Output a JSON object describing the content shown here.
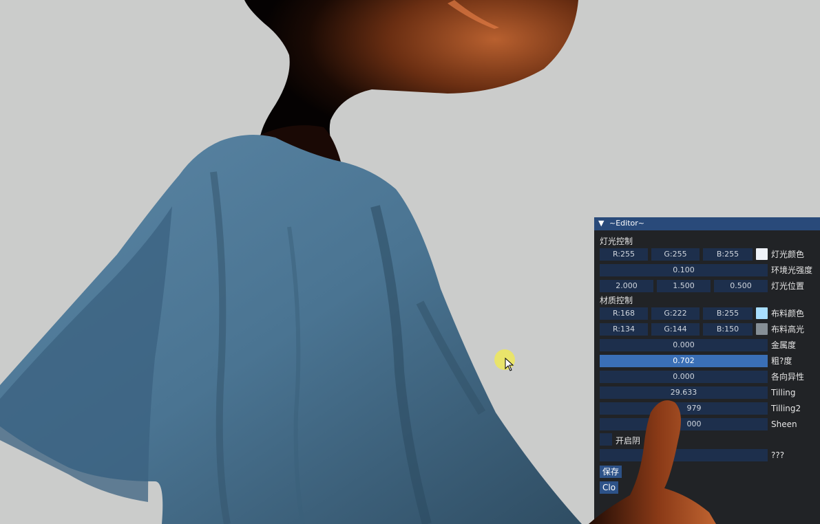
{
  "viewport": {
    "description_icon": "character-3d-scene",
    "colors": {
      "background": "#cbcccb",
      "cloth": "#4d7896",
      "skin_shadow": "#1a0c06",
      "skin": "#a85028"
    }
  },
  "editor": {
    "title": "~Editor~",
    "collapse_icon": "triangle-down-icon",
    "light_section": {
      "heading": "灯光控制",
      "light_color": {
        "r": "R:255",
        "g": "G:255",
        "b": "B:255",
        "label": "灯光颜色",
        "swatch": "#eef2f8"
      },
      "ambient": {
        "value": "0.100",
        "label": "环境光强度"
      },
      "light_pos": {
        "x": "2.000",
        "y": "1.500",
        "z": "0.500",
        "label": "灯光位置"
      }
    },
    "material_section": {
      "heading": "材质控制",
      "cloth_color": {
        "r": "R:168",
        "g": "G:222",
        "b": "B:255",
        "label": "布料颜色",
        "swatch": "#a8defe"
      },
      "cloth_spec": {
        "r": "R:134",
        "g": "G:144",
        "b": "B:150",
        "label": "布料高光",
        "swatch": "#868f96"
      },
      "metallic": {
        "value": "0.000",
        "label": "金属度"
      },
      "roughness": {
        "value": "0.702",
        "label": "粗?度"
      },
      "anisotropy": {
        "value": "0.000",
        "label": "各向异性"
      },
      "tilling": {
        "value": "29.633",
        "label": "Tilling"
      },
      "tilling2": {
        "value": "979",
        "label": "Tilling2"
      },
      "sheen": {
        "value": "000",
        "label": "Sheen"
      },
      "toggle_label": "开启阴",
      "unknown": {
        "value": "",
        "label": "???"
      }
    },
    "save_button": "保存",
    "close_button": "Clo"
  },
  "accent": {
    "title_bar": "#294a7a",
    "field": "#1d2f4c",
    "active_field": "#3a6fb6",
    "cursor_highlight": "#eee85a"
  }
}
